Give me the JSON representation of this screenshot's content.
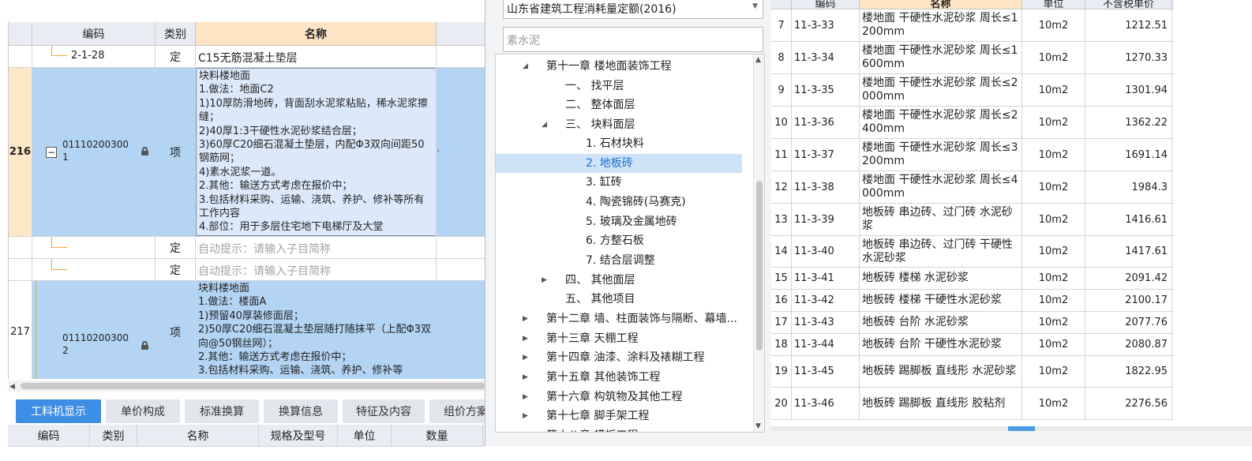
{
  "bill_grid": {
    "headers": {
      "code": "编码",
      "type": "类别",
      "name": "名称"
    },
    "rows": [
      {
        "code": "2-1-28",
        "type": "定",
        "name": "C15无筋混凝土垫层"
      },
      {
        "num": "216",
        "collapse": "−",
        "code": "01110200300\n1",
        "type": "项",
        "name": "块料楼地面\n1.做法：地面C2\n1)10厚防滑地砖，背面刮水泥浆粘贴，稀水泥浆擦缝；\n2)40厚1:3干硬性水泥砂浆结合层；\n3)60厚C20细石混凝土垫层，内配Φ3双向间距50钢筋网；\n4)素水泥浆一道。\n2.其他：输送方式考虑在报价中；\n3.包括材料采购、运输、浇筑、养护、修补等所有工作内容\n4.部位：用于多层住宅地下电梯厅及大堂",
        "ellipsis": "..."
      },
      {
        "type": "定",
        "name": "自动提示：请输入子目简称"
      },
      {
        "type": "定",
        "name": "自动提示：请输入子目简称"
      },
      {
        "num": "217",
        "code": "01110200300\n2",
        "type": "项",
        "name": "块料楼地面\n1.做法：楼面A\n1)预留40厚装修面层；\n2)50厚C20细石混凝土垫层随打随抹平（上配Φ3双向@50钢丝网）；\n2.其他：输送方式考虑在报价中；\n3.包括材料采购、运输、浇筑、养护、修补等"
      }
    ]
  },
  "bottom_tabs": [
    "工料机显示",
    "单价构成",
    "标准换算",
    "换算信息",
    "特征及内容",
    "组价方案"
  ],
  "bottom_headers": [
    "编码",
    "类别",
    "名称",
    "规格及型号",
    "单位",
    "数量"
  ],
  "dialog": {
    "quota_library": "山东省建筑工程消耗量定额(2016)",
    "search_placeholder": "素水泥",
    "tree": [
      {
        "label": "第十一章 楼地面装饰工程",
        "toggle": "◢"
      },
      {
        "label": "一、 找平层"
      },
      {
        "label": "二、 整体面层"
      },
      {
        "label": "三、 块料面层",
        "toggle": "◢"
      },
      {
        "label": "1. 石材块料"
      },
      {
        "label": "2. 地板砖",
        "selected": true
      },
      {
        "label": "3. 缸砖"
      },
      {
        "label": "4. 陶瓷锦砖(马赛克)"
      },
      {
        "label": "5. 玻璃及金属地砖"
      },
      {
        "label": "6. 方整石板"
      },
      {
        "label": "7. 结合层调整"
      },
      {
        "label": "四、 其他面层",
        "toggle": "▶"
      },
      {
        "label": "五、 其他项目"
      },
      {
        "label": "第十二章 墙、柱面装饰与隔断、幕墙...",
        "toggle": "▶"
      },
      {
        "label": "第十三章 天棚工程",
        "toggle": "▶"
      },
      {
        "label": "第十四章 油漆、涂料及裱糊工程",
        "toggle": "▶"
      },
      {
        "label": "第十五章 其他装饰工程",
        "toggle": "▶"
      },
      {
        "label": "第十六章 构筑物及其他工程",
        "toggle": "▶"
      },
      {
        "label": "第十七章 脚手架工程",
        "toggle": "▶"
      },
      {
        "label": "第十八章 模板工程",
        "toggle": "▶"
      }
    ],
    "quota_headers": [
      "",
      "编码",
      "名称",
      "单位",
      "不含税单价"
    ],
    "quotas": [
      {
        "n": "7",
        "code": "11-3-33",
        "name": "楼地面 干硬性水泥砂浆 周长≤1200mm",
        "unit": "10m2",
        "price": "1212.51"
      },
      {
        "n": "8",
        "code": "11-3-34",
        "name": "楼地面 干硬性水泥砂浆 周长≤1600mm",
        "unit": "10m2",
        "price": "1270.33"
      },
      {
        "n": "9",
        "code": "11-3-35",
        "name": "楼地面 干硬性水泥砂浆 周长≤2000mm",
        "unit": "10m2",
        "price": "1301.94"
      },
      {
        "n": "10",
        "code": "11-3-36",
        "name": "楼地面 干硬性水泥砂浆 周长≤2400mm",
        "unit": "10m2",
        "price": "1362.22"
      },
      {
        "n": "11",
        "code": "11-3-37",
        "name": "楼地面 干硬性水泥砂浆 周长≤3200mm",
        "unit": "10m2",
        "price": "1691.14"
      },
      {
        "n": "12",
        "code": "11-3-38",
        "name": "楼地面 干硬性水泥砂浆 周长≤4000mm",
        "unit": "10m2",
        "price": "1984.3"
      },
      {
        "n": "13",
        "code": "11-3-39",
        "name": "地板砖 串边砖、过门砖 水泥砂浆",
        "unit": "10m2",
        "price": "1416.61"
      },
      {
        "n": "14",
        "code": "11-3-40",
        "name": "地板砖 串边砖、过门砖 干硬性水泥砂浆",
        "unit": "10m2",
        "price": "1417.61"
      },
      {
        "n": "15",
        "code": "11-3-41",
        "name": "地板砖 楼梯 水泥砂浆",
        "unit": "10m2",
        "price": "2091.42"
      },
      {
        "n": "16",
        "code": "11-3-42",
        "name": "地板砖 楼梯 干硬性水泥砂浆",
        "unit": "10m2",
        "price": "2100.17"
      },
      {
        "n": "17",
        "code": "11-3-43",
        "name": "地板砖 台阶 水泥砂浆",
        "unit": "10m2",
        "price": "2077.76"
      },
      {
        "n": "18",
        "code": "11-3-44",
        "name": "地板砖 台阶 干硬性水泥砂浆",
        "unit": "10m2",
        "price": "2080.87"
      },
      {
        "n": "19",
        "code": "11-3-45",
        "name": "地板砖 踢脚板 直线形 水泥砂浆",
        "unit": "10m2",
        "price": "1822.95"
      },
      {
        "n": "20",
        "code": "11-3-46",
        "name": "地板砖 踢脚板 直线形 胶粘剂",
        "unit": "10m2",
        "price": "2276.56"
      }
    ]
  }
}
